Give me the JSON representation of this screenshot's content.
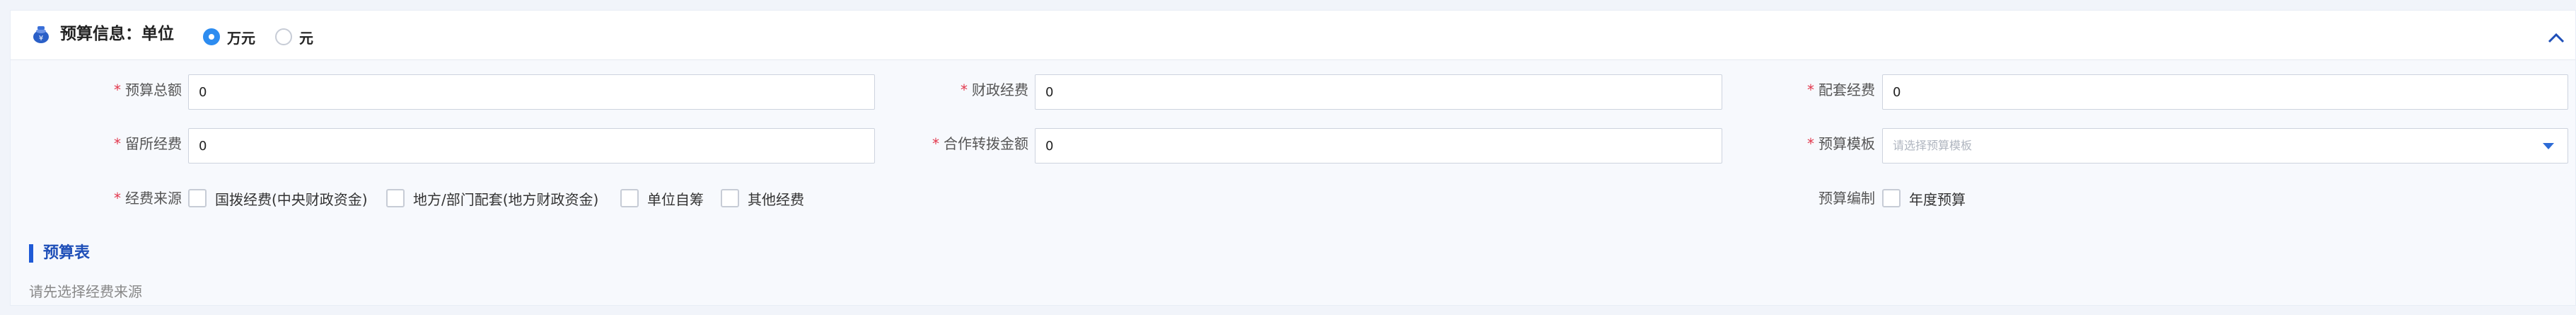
{
  "header": {
    "title": "预算信息：单位",
    "unit_options": [
      {
        "label": "万元",
        "selected": true
      },
      {
        "label": "元",
        "selected": false
      }
    ]
  },
  "fields": {
    "total_budget": {
      "label": "预算总额",
      "required": true,
      "value": "0"
    },
    "fiscal_funds": {
      "label": "财政经费",
      "required": true,
      "value": "0"
    },
    "matching_funds": {
      "label": "配套经费",
      "required": true,
      "value": "0"
    },
    "retained_funds": {
      "label": "留所经费",
      "required": true,
      "value": "0"
    },
    "cooperation_transfer": {
      "label": "合作转拨金额",
      "required": true,
      "value": "0"
    },
    "budget_template": {
      "label": "预算模板",
      "required": true,
      "placeholder": "请选择预算模板"
    }
  },
  "funding_source": {
    "label": "经费来源",
    "required": true,
    "options": [
      {
        "label": "国拨经费(中央财政资金)",
        "checked": false
      },
      {
        "label": "地方/部门配套(地方财政资金)",
        "checked": false
      },
      {
        "label": "单位自筹",
        "checked": false
      },
      {
        "label": "其他经费",
        "checked": false
      }
    ]
  },
  "budget_compilation": {
    "label": "预算编制",
    "options": [
      {
        "label": "年度预算",
        "checked": false
      }
    ]
  },
  "budget_table": {
    "title": "预算表",
    "hint": "请先选择经费来源"
  },
  "colors": {
    "accent": "#2d8cf0",
    "required": "#e2384d",
    "section": "#1f5ad6"
  },
  "icons": {
    "header": "budget-pot-icon",
    "collapse": "chevron-up-icon",
    "select": "caret-down-icon"
  }
}
